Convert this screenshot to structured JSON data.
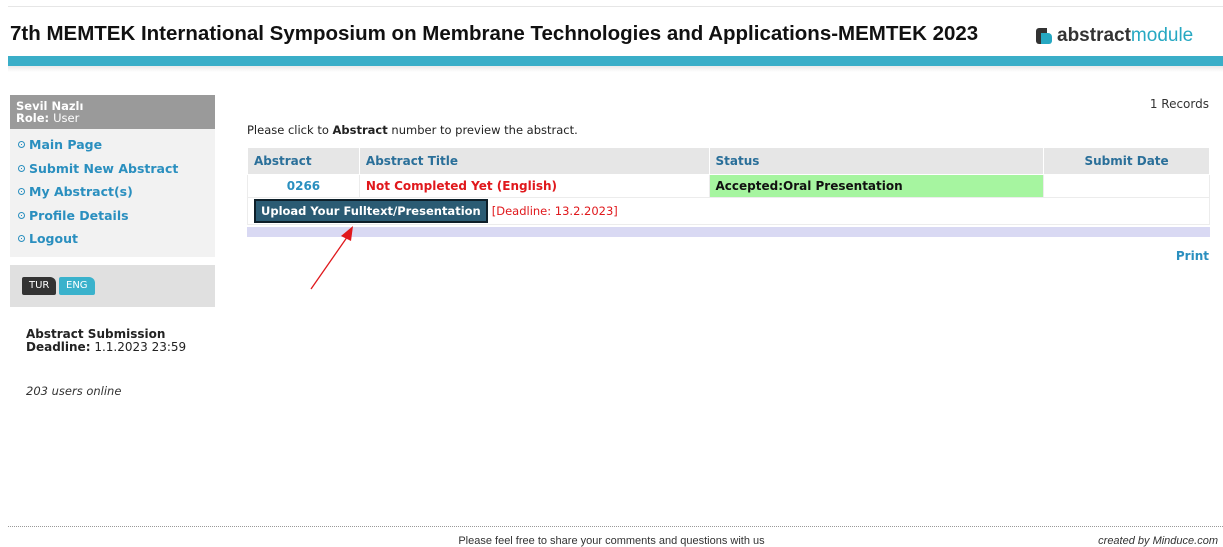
{
  "header": {
    "title": "7th MEMTEK International Symposium on Membrane Technologies and Applications-MEMTEK 2023",
    "logo_part1": "abstract",
    "logo_part2": "module",
    "bar_color": "#3aaec8"
  },
  "sidebar": {
    "user_name": "Sevil Nazlı",
    "role_label": "Role:",
    "role_value": "User",
    "menu": [
      {
        "label": "Main Page"
      },
      {
        "label": "Submit New Abstract"
      },
      {
        "label": "My Abstract(s)"
      },
      {
        "label": "Profile Details"
      },
      {
        "label": "Logout"
      }
    ],
    "lang_tur": "TUR",
    "lang_eng": "ENG",
    "deadline_label": "Abstract Submission",
    "deadline_prefix": "Deadline:",
    "deadline_value": "1.1.2023 23:59",
    "online_text": "203 users online"
  },
  "main": {
    "records": "1 Records",
    "instruction_pre": "Please click to",
    "instruction_bold": "Abstract",
    "instruction_post": "number to preview the abstract.",
    "columns": [
      "Abstract",
      "Abstract Title",
      "Status",
      "Submit Date"
    ],
    "row": {
      "abstract_no": "0266",
      "title": "Not Completed Yet (English)",
      "status": "Accepted:Oral Presentation",
      "submit_date": ""
    },
    "upload_button": "Upload Your Fulltext/Presentation",
    "upload_deadline": "[Deadline: 13.2.2023]",
    "print_label": "Print",
    "status_color": "#a6f5a0",
    "title_color": "#e0181c"
  },
  "footer": {
    "text": "Please feel free to share your comments and questions with us",
    "credit": "created by Minduce.com"
  }
}
